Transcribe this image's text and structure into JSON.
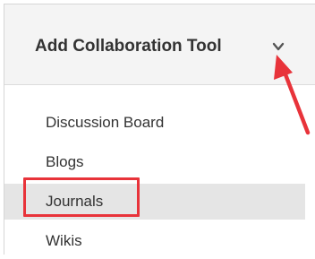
{
  "menu": {
    "header_label": "Add Collaboration Tool",
    "items": [
      {
        "label": "Discussion Board"
      },
      {
        "label": "Blogs"
      },
      {
        "label": "Journals"
      },
      {
        "label": "Wikis"
      }
    ],
    "selected_index": 2
  },
  "colors": {
    "annotation_red": "#e8333a",
    "header_bg": "#f4f4f4",
    "selected_bg": "#e5e5e5",
    "text": "#333333"
  },
  "icons": {
    "header_chevron": "chevron-down-icon",
    "annotation_arrow": "red-arrow-annotation"
  }
}
